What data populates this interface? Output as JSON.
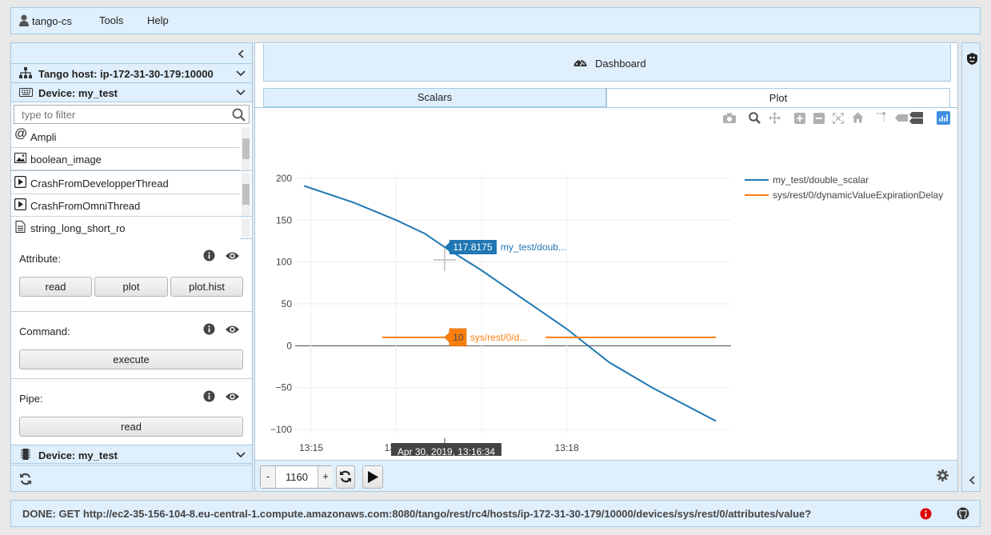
{
  "topbar": {
    "user": "tango-cs",
    "menu": [
      "Tools",
      "Help"
    ]
  },
  "left": {
    "tango_host_label": "Tango host: ip-172-31-30-179:10000",
    "device_label": "Device: my_test",
    "filter_placeholder": "type to filter",
    "attributes": [
      "Ampli",
      "boolean_image"
    ],
    "commands": [
      "CrashFromDevelopperThread",
      "CrashFromOmniThread"
    ],
    "pipes": [
      "string_long_short_ro"
    ],
    "attribute_section": {
      "label": "Attribute:",
      "buttons": [
        "read",
        "plot",
        "plot.hist"
      ]
    },
    "command_section": {
      "label": "Command:",
      "button": "execute"
    },
    "pipe_section": {
      "label": "Pipe:",
      "button": "read"
    },
    "bottom_device_label": "Device: my_test"
  },
  "main": {
    "title": "Dashboard",
    "tabs": [
      {
        "label": "Scalars",
        "active": false
      },
      {
        "label": "Plot",
        "active": true
      }
    ],
    "controls": {
      "minus": "-",
      "value": "1160",
      "plus": "+"
    }
  },
  "status": {
    "text": "DONE: GET http://ec2-35-156-104-8.eu-central-1.compute.amazonaws.com:8080/tango/rest/rc4/hosts/ip-172-31-30-179/10000/devices/sys/rest/0/attributes/value?"
  },
  "chart_data": {
    "type": "line",
    "x_tick_labels": [
      "13:15\nApr 30, 2019",
      "13:16",
      "13:17",
      "13:18"
    ],
    "x_tick_positions": [
      "13:15",
      "13:16",
      "13:17",
      "13:18"
    ],
    "yticks": [
      200,
      150,
      100,
      50,
      0,
      -50,
      -100
    ],
    "ylim": [
      -100,
      200
    ],
    "xlim": [
      "13:15",
      "13:19:50"
    ],
    "series": [
      {
        "name": "my_test/double_scalar",
        "color": "#1f77b4",
        "x": [
          "13:14:55",
          "13:15:30",
          "13:16:00",
          "13:16:20",
          "13:16:34",
          "13:17:00",
          "13:17:30",
          "13:18:00",
          "13:18:30",
          "13:19:00",
          "13:19:45"
        ],
        "values": [
          191,
          171,
          150,
          134,
          117.8175,
          90,
          55,
          20,
          -20,
          -50,
          -90
        ]
      },
      {
        "name": "sys/rest/0/dynamicValueExpirationDelay",
        "color": "#ff7f0e",
        "x": [
          "13:15:50",
          "13:19:45"
        ],
        "values": [
          10,
          10
        ]
      }
    ],
    "hover": {
      "time_label": "Apr 30, 2019, 13:16:34",
      "points": [
        {
          "value": "117.8175",
          "label": "my_test/doub..."
        },
        {
          "value": "10",
          "label": "sys/rest/0/d..."
        }
      ]
    },
    "legend_position": "top-right"
  },
  "icons": {
    "user": "user-icon",
    "search": "search-icon",
    "info": "info-icon",
    "eye": "eye-icon",
    "dashboard": "dashboard-icon",
    "refresh": "refresh-icon",
    "play": "play-icon",
    "gear": "gear-icon",
    "error": "error-icon",
    "github": "github-icon"
  }
}
